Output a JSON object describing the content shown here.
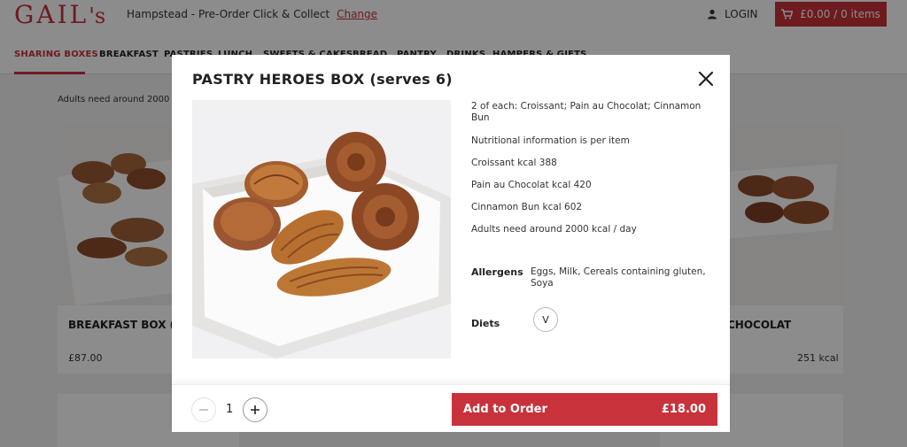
{
  "header": {
    "logo": "GAIL",
    "logo_suffix": "'s",
    "location": "Hampstead - Pre-Order Click & Collect",
    "change_label": "Change",
    "login_label": "LOGIN",
    "cart_label": "£0.00 / 0 items"
  },
  "nav": {
    "items": [
      "SHARING BOXES",
      "BREAKFAST",
      "PASTRIES",
      "LUNCH",
      "SWEETS & CAKES",
      "BREAD",
      "PANTRY",
      "DRINKS",
      "HAMPERS & GIFTS"
    ]
  },
  "page": {
    "intro": "Adults need around 2000 k"
  },
  "cards": [
    {
      "title": "BREAKFAST BOX (se",
      "price": "£87.00"
    },
    {
      "title": "CHOCOLAT",
      "price": "251 kcal"
    }
  ],
  "modal": {
    "title": "PASTRY HEROES BOX (serves 6)",
    "description": [
      "2 of each: Croissant; Pain au Chocolat; Cinnamon Bun",
      "Nutritional information is per item",
      "Croissant kcal 388",
      "Pain au Chocolat kcal 420",
      "Cinnamon Bun kcal 602",
      "Adults need around 2000 kcal / day"
    ],
    "allergens_label": "Allergens",
    "allergens_value": "Eggs, Milk, Cereals containing gluten, Soya",
    "diets_label": "Diets",
    "diet_badge": "V",
    "quantity": "1",
    "add_label": "Add to Order",
    "add_price": "£18.00"
  },
  "colors": {
    "brand": "#c8323b"
  }
}
